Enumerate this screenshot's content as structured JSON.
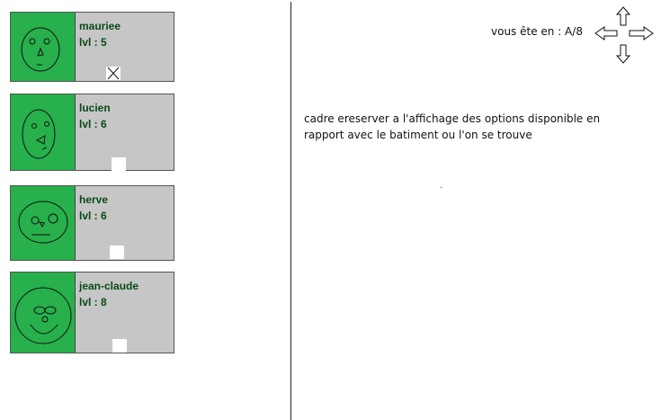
{
  "party": {
    "members": [
      {
        "name": "mauriee",
        "level": "lvl : 5",
        "slot_icon": "close-x-icon",
        "face_icon": "happy-face-icon"
      },
      {
        "name": "lucien",
        "level": "lvl : 6",
        "slot_icon": "empty-slot",
        "face_icon": "oval-face-icon"
      },
      {
        "name": "herve",
        "level": "lvl : 6",
        "slot_icon": "empty-slot",
        "face_icon": "wide-face-icon"
      },
      {
        "name": "jean-claude",
        "level": "lvl : 8",
        "slot_icon": "empty-slot",
        "face_icon": "smiling-face-icon"
      }
    ]
  },
  "location": {
    "text": "vous ête en : A/8"
  },
  "compass": {
    "icon": "four-direction-arrows-icon",
    "directions": [
      "up",
      "left",
      "right",
      "down"
    ]
  },
  "info_panel": {
    "text": "cadre ereserver a l'affichage des options disponible en rapport avec le batiment ou l'on se trouve"
  },
  "colors": {
    "portrait_bg": "#27b04c",
    "card_bg": "#c6c6c6",
    "name_text": "#0a4a14"
  }
}
